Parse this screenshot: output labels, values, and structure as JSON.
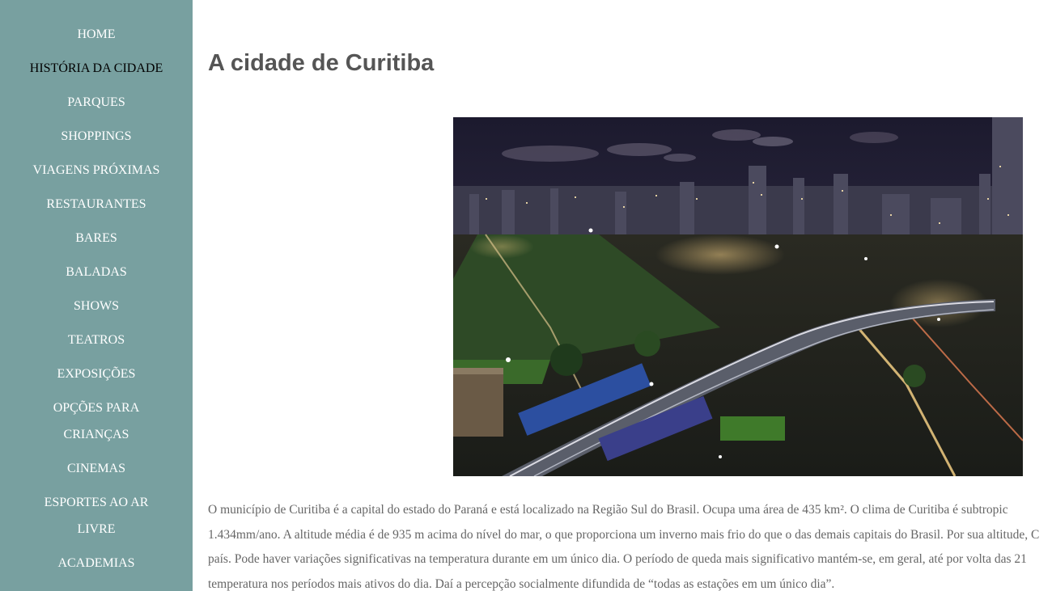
{
  "sidebar": {
    "items": [
      {
        "label": "HOME"
      },
      {
        "label": "HISTÓRIA DA CIDADE"
      },
      {
        "label": "PARQUES"
      },
      {
        "label": "SHOPPINGS"
      },
      {
        "label": "VIAGENS PRÓXIMAS"
      },
      {
        "label": "RESTAURANTES"
      },
      {
        "label": "BARES"
      },
      {
        "label": "BALADAS"
      },
      {
        "label": "SHOWS"
      },
      {
        "label": "TEATROS"
      },
      {
        "label": "EXPOSIÇÕES"
      },
      {
        "label_line1": "OPÇÕES PARA",
        "label_line2": "CRIANÇAS"
      },
      {
        "label": "CINEMAS"
      },
      {
        "label_line1": "ESPORTES AO AR",
        "label_line2": "LIVRE"
      },
      {
        "label": "ACADEMIAS"
      }
    ],
    "active_index": 1,
    "background_color": "#78a0a0"
  },
  "main": {
    "title": "A cidade de Curitiba",
    "image": {
      "icon": "city-night-photo"
    },
    "paragraph_lines": [
      "O município de Curitiba é a capital do estado do Paraná e está localizado na Região Sul do Brasil. Ocupa uma área de 435 km². O clima de Curitiba é subtropic",
      "1.434mm/ano. A altitude média é de 935 m acima do nível do mar, o que proporciona um inverno mais frio do que o das demais capitais do Brasil. Por sua altitude, C",
      "país. Pode haver variações significativas na temperatura durante em um único dia. O período de queda mais significativo mantém-se, em geral, até por volta das 21",
      "temperatura nos períodos mais ativos do dia. Daí a percepção socialmente difundida de “todas as estações em um único dia”."
    ]
  }
}
